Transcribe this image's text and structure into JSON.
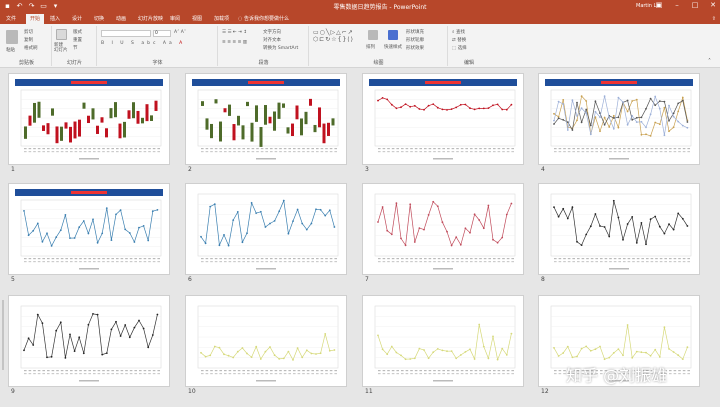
{
  "window": {
    "title": "零售数据日趋势报告 - PowerPoint",
    "user": "Martin Liu",
    "qat_icons": [
      "save-icon",
      "undo-icon",
      "redo-icon",
      "start-from-beginning-icon",
      "customize-icon"
    ]
  },
  "tabs": [
    {
      "label": "文件",
      "active": false
    },
    {
      "label": "开始",
      "active": true
    },
    {
      "label": "插入",
      "active": false
    },
    {
      "label": "设计",
      "active": false
    },
    {
      "label": "切换",
      "active": false
    },
    {
      "label": "动画",
      "active": false
    },
    {
      "label": "幻灯片放映",
      "active": false
    },
    {
      "label": "审阅",
      "active": false
    },
    {
      "label": "视图",
      "active": false
    },
    {
      "label": "加载项",
      "active": false
    }
  ],
  "tell_me": "告诉我你想要做什么",
  "ribbon": {
    "clipboard": {
      "label": "剪贴板",
      "paste": "粘贴",
      "cut": "剪切",
      "copy": "复制",
      "format_painter": "格式刷"
    },
    "slides": {
      "label": "幻灯片",
      "new_slide": "新建\n幻灯片",
      "layout": "版式",
      "reset": "重置",
      "section": "节"
    },
    "font": {
      "label": "字体",
      "font_name": "",
      "font_size": "0",
      "buttons": [
        "B",
        "I",
        "U",
        "S",
        "abc",
        "A",
        "Aa",
        "A"
      ]
    },
    "paragraph": {
      "label": "段落",
      "text_direction": "文字方向",
      "align_text": "对齐文本",
      "smartart": "转换为 SmartArt"
    },
    "drawing": {
      "label": "绘图",
      "arrange": "排列",
      "quick_styles": "快速样式",
      "shape_fill": "形状填充",
      "shape_outline": "形状轮廓",
      "shape_effects": "形状效果"
    },
    "editing": {
      "label": "编辑",
      "find": "查找",
      "replace": "替换",
      "select": "选择"
    }
  },
  "slides": [
    {
      "number": "1",
      "title": "",
      "chart": "candle"
    },
    {
      "number": "2",
      "title": "",
      "chart": "candle"
    },
    {
      "number": "3",
      "title": "",
      "chart": "line-red"
    },
    {
      "number": "4",
      "title": "",
      "chart": "line-multi"
    },
    {
      "number": "5",
      "title": "",
      "chart": "line-blue"
    },
    {
      "number": "6",
      "title": "",
      "chart": "line-blue"
    },
    {
      "number": "7",
      "title": "",
      "chart": "line-pink"
    },
    {
      "number": "8",
      "title": "",
      "chart": "line-dark"
    },
    {
      "number": "9",
      "title": "",
      "chart": "line-dark"
    },
    {
      "number": "10",
      "title": "",
      "chart": "line-yellow"
    },
    {
      "number": "11",
      "title": "",
      "chart": "line-yellow"
    },
    {
      "number": "12",
      "title": "",
      "chart": "line-yellow"
    }
  ],
  "colors": {
    "accent": "#b7472a",
    "slide_header": "#1f4e9a",
    "bar_up": "#c0111f",
    "bar_down": "#4e6b2a",
    "line_red": "#c0111f",
    "line_blue": "#3a7fb0",
    "line_pink": "#c04a5a",
    "line_dark": "#333333",
    "line_yellow": "#d6d97a"
  },
  "watermark": "知乎 @刘振雄"
}
